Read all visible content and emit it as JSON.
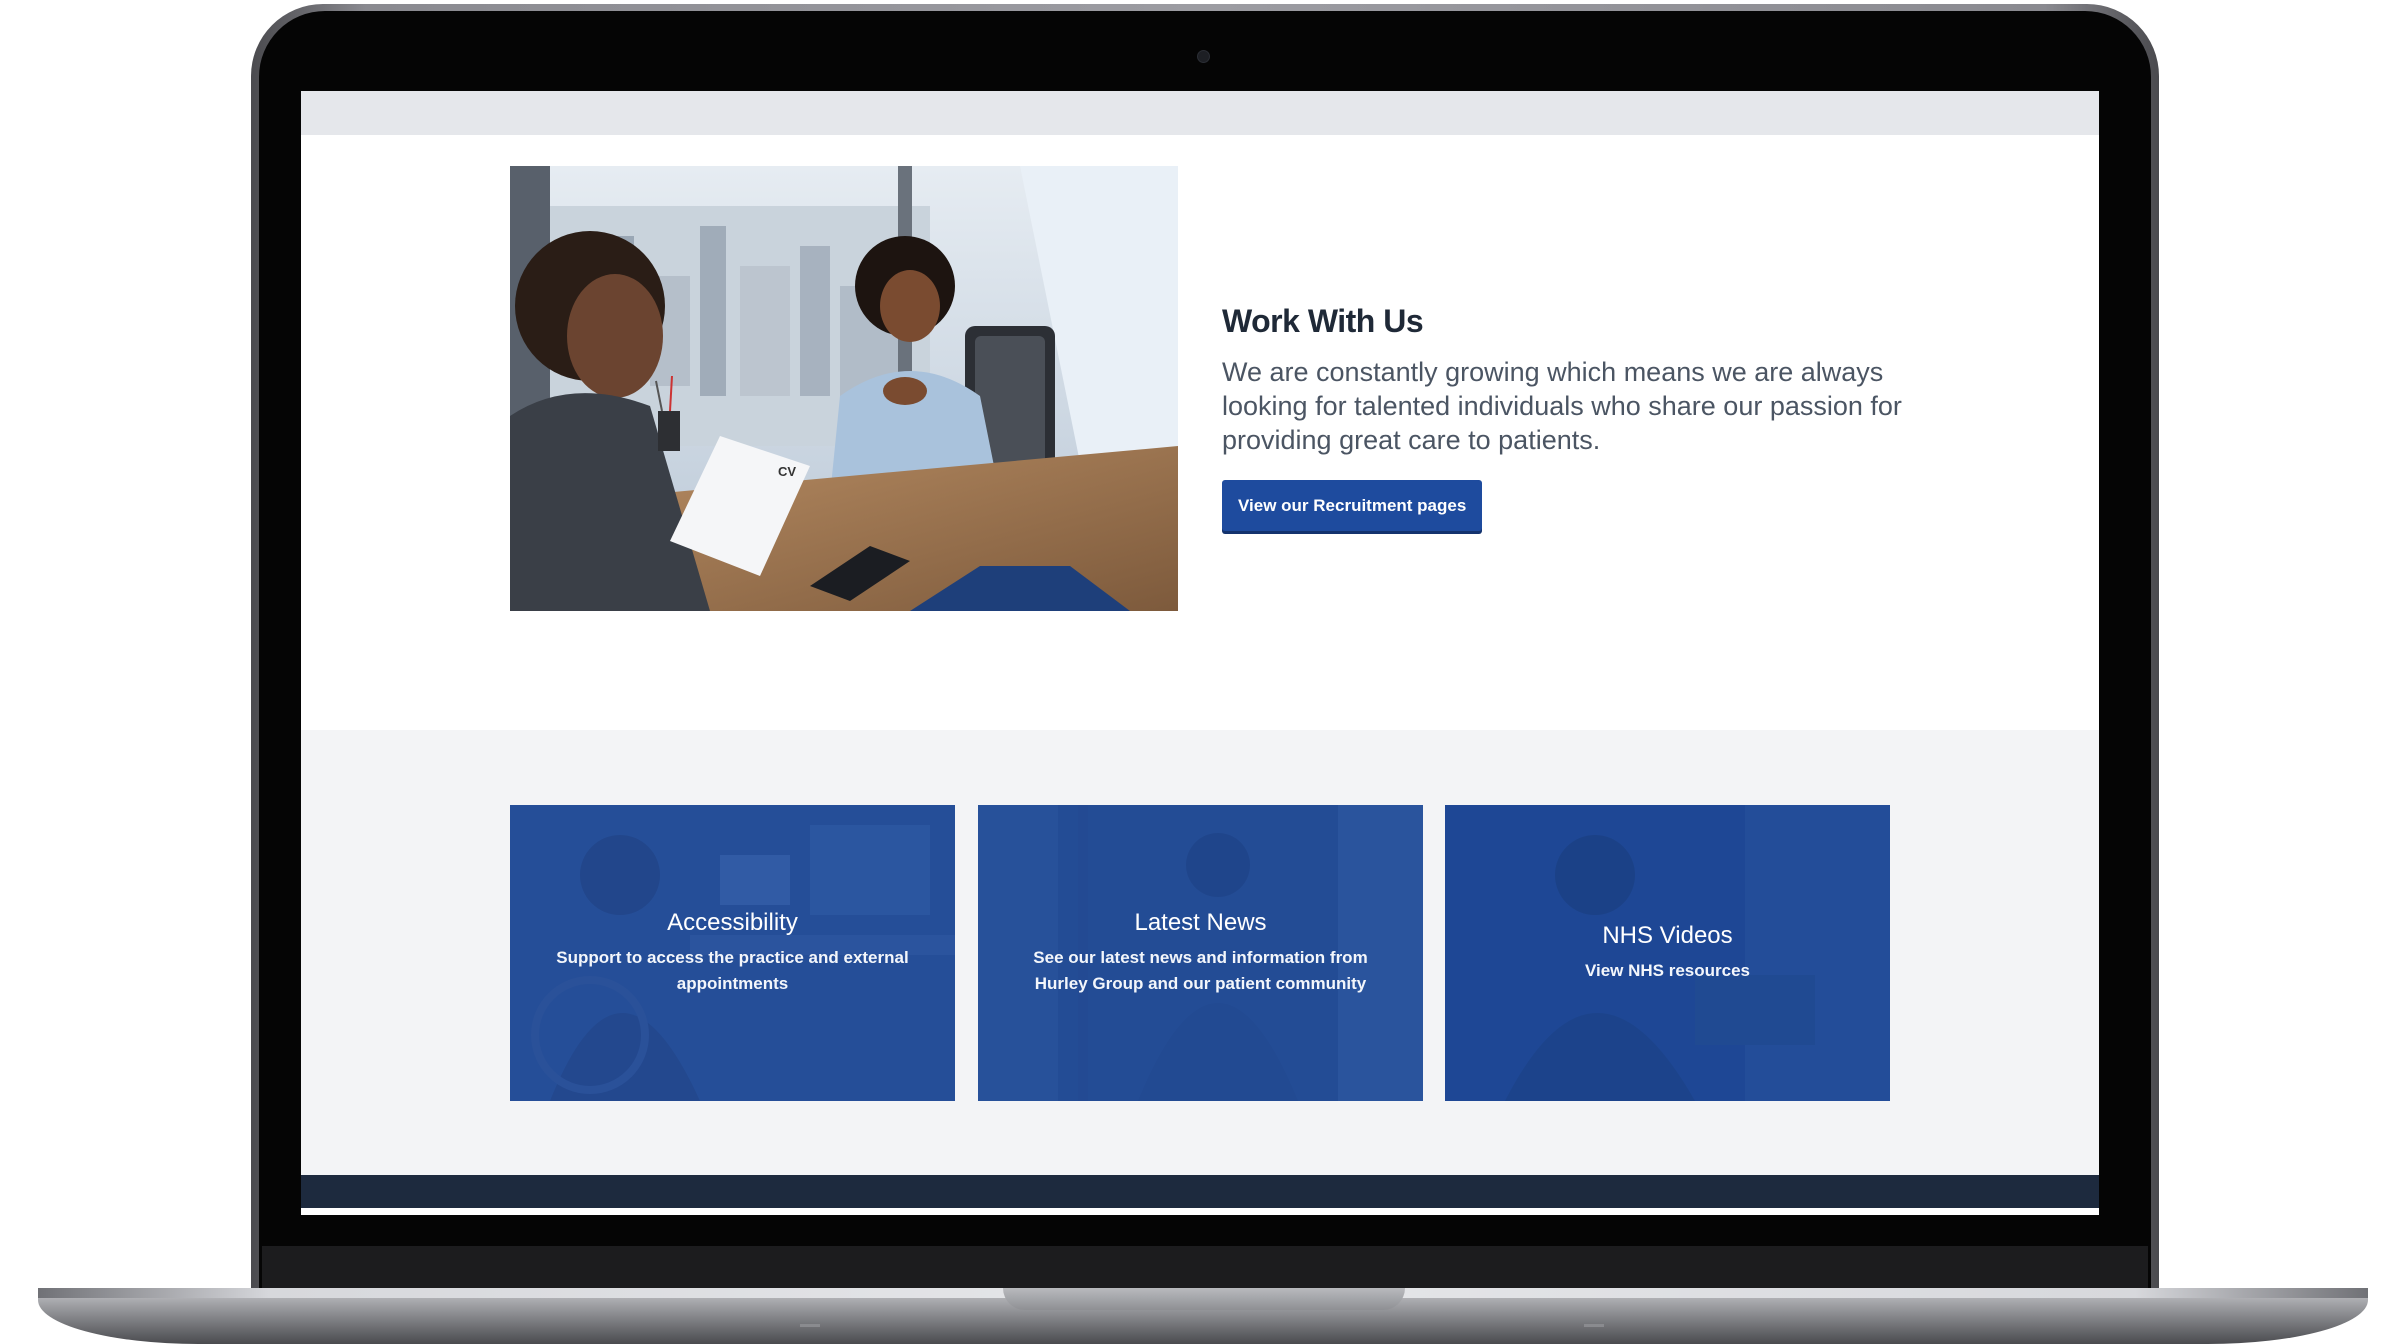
{
  "work": {
    "title": "Work With Us",
    "body": "We are constantly growing which means we are always looking for talented individuals who share our passion for providing great care to patients.",
    "button_label": "View our Recruitment pages",
    "photo_cv_label": "CV"
  },
  "cards": [
    {
      "title": "Accessibility",
      "description": "Support to access the practice and external appointments"
    },
    {
      "title": "Latest News",
      "description": "See our latest news and information from Hurley Group and our patient community"
    },
    {
      "title": "NHS Videos",
      "description": "View NHS resources"
    }
  ],
  "colors": {
    "primary_button": "#1e4b9e",
    "card_overlay": "#234f97",
    "footer": "#1d2a3e",
    "section_gray": "#f3f4f6"
  }
}
